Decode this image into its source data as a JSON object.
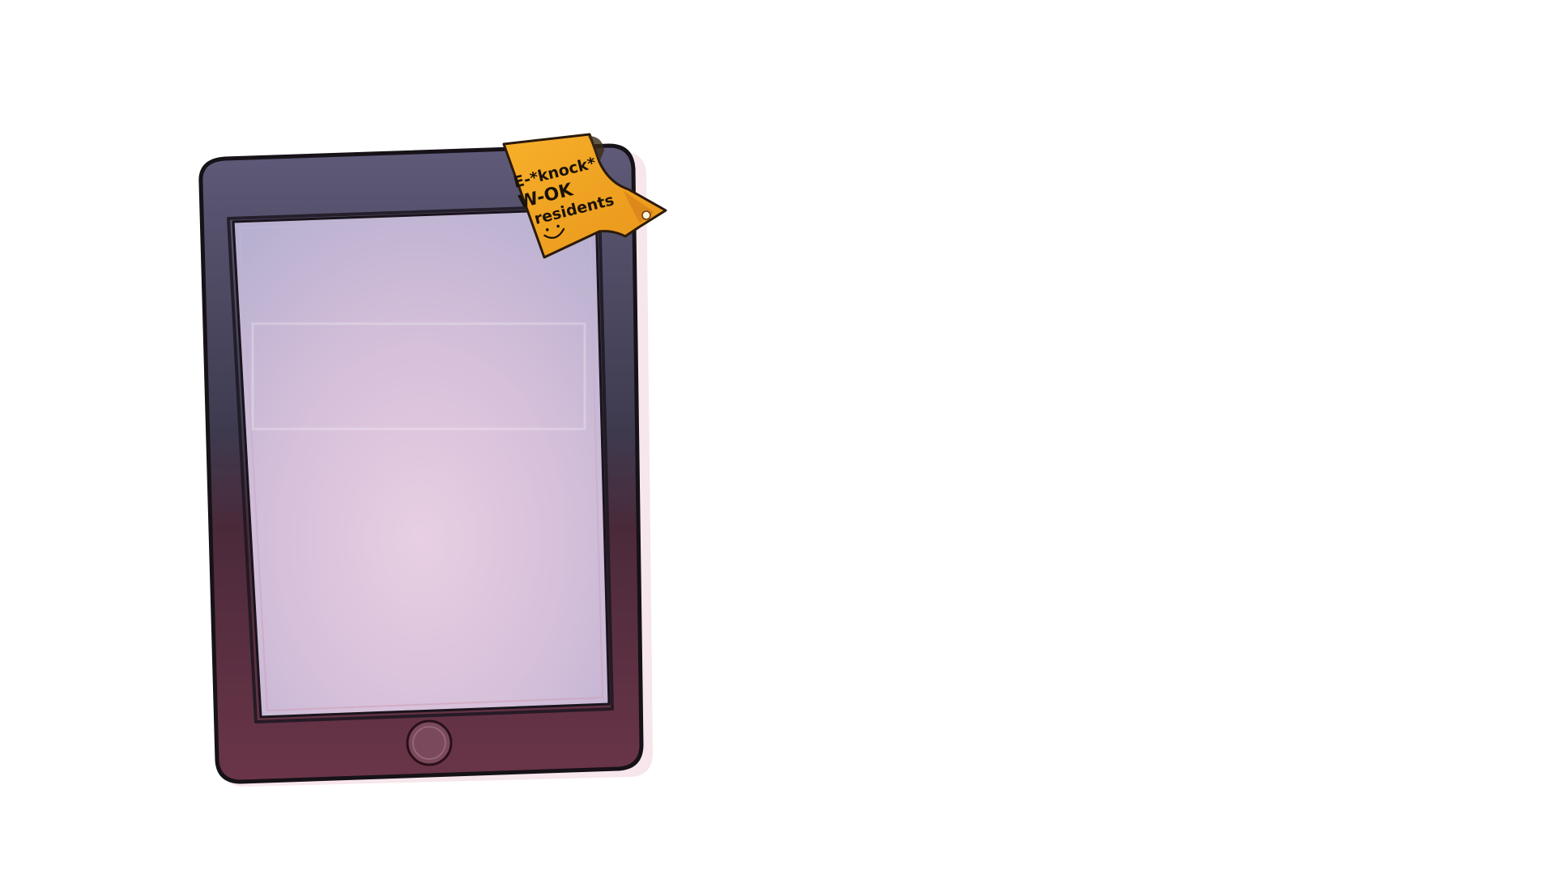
{
  "tablet": {
    "colors": {
      "frame_top": "#5e5a78",
      "frame_bottom": "#5a2a3c",
      "screen_top": "#b9afcf",
      "screen_mid": "#d8c6de",
      "screen_bottom": "#d2a9c0",
      "home_button_ring": "#4a2030"
    },
    "home_button_icon": "circle-home-button-icon"
  },
  "sticky_note": {
    "lines": [
      "E-*knock*",
      "W-OK",
      "residents"
    ],
    "smiley_icon": "smiley-face-icon",
    "color": "#f5a623",
    "pin_icon": "pin-dot-icon"
  }
}
